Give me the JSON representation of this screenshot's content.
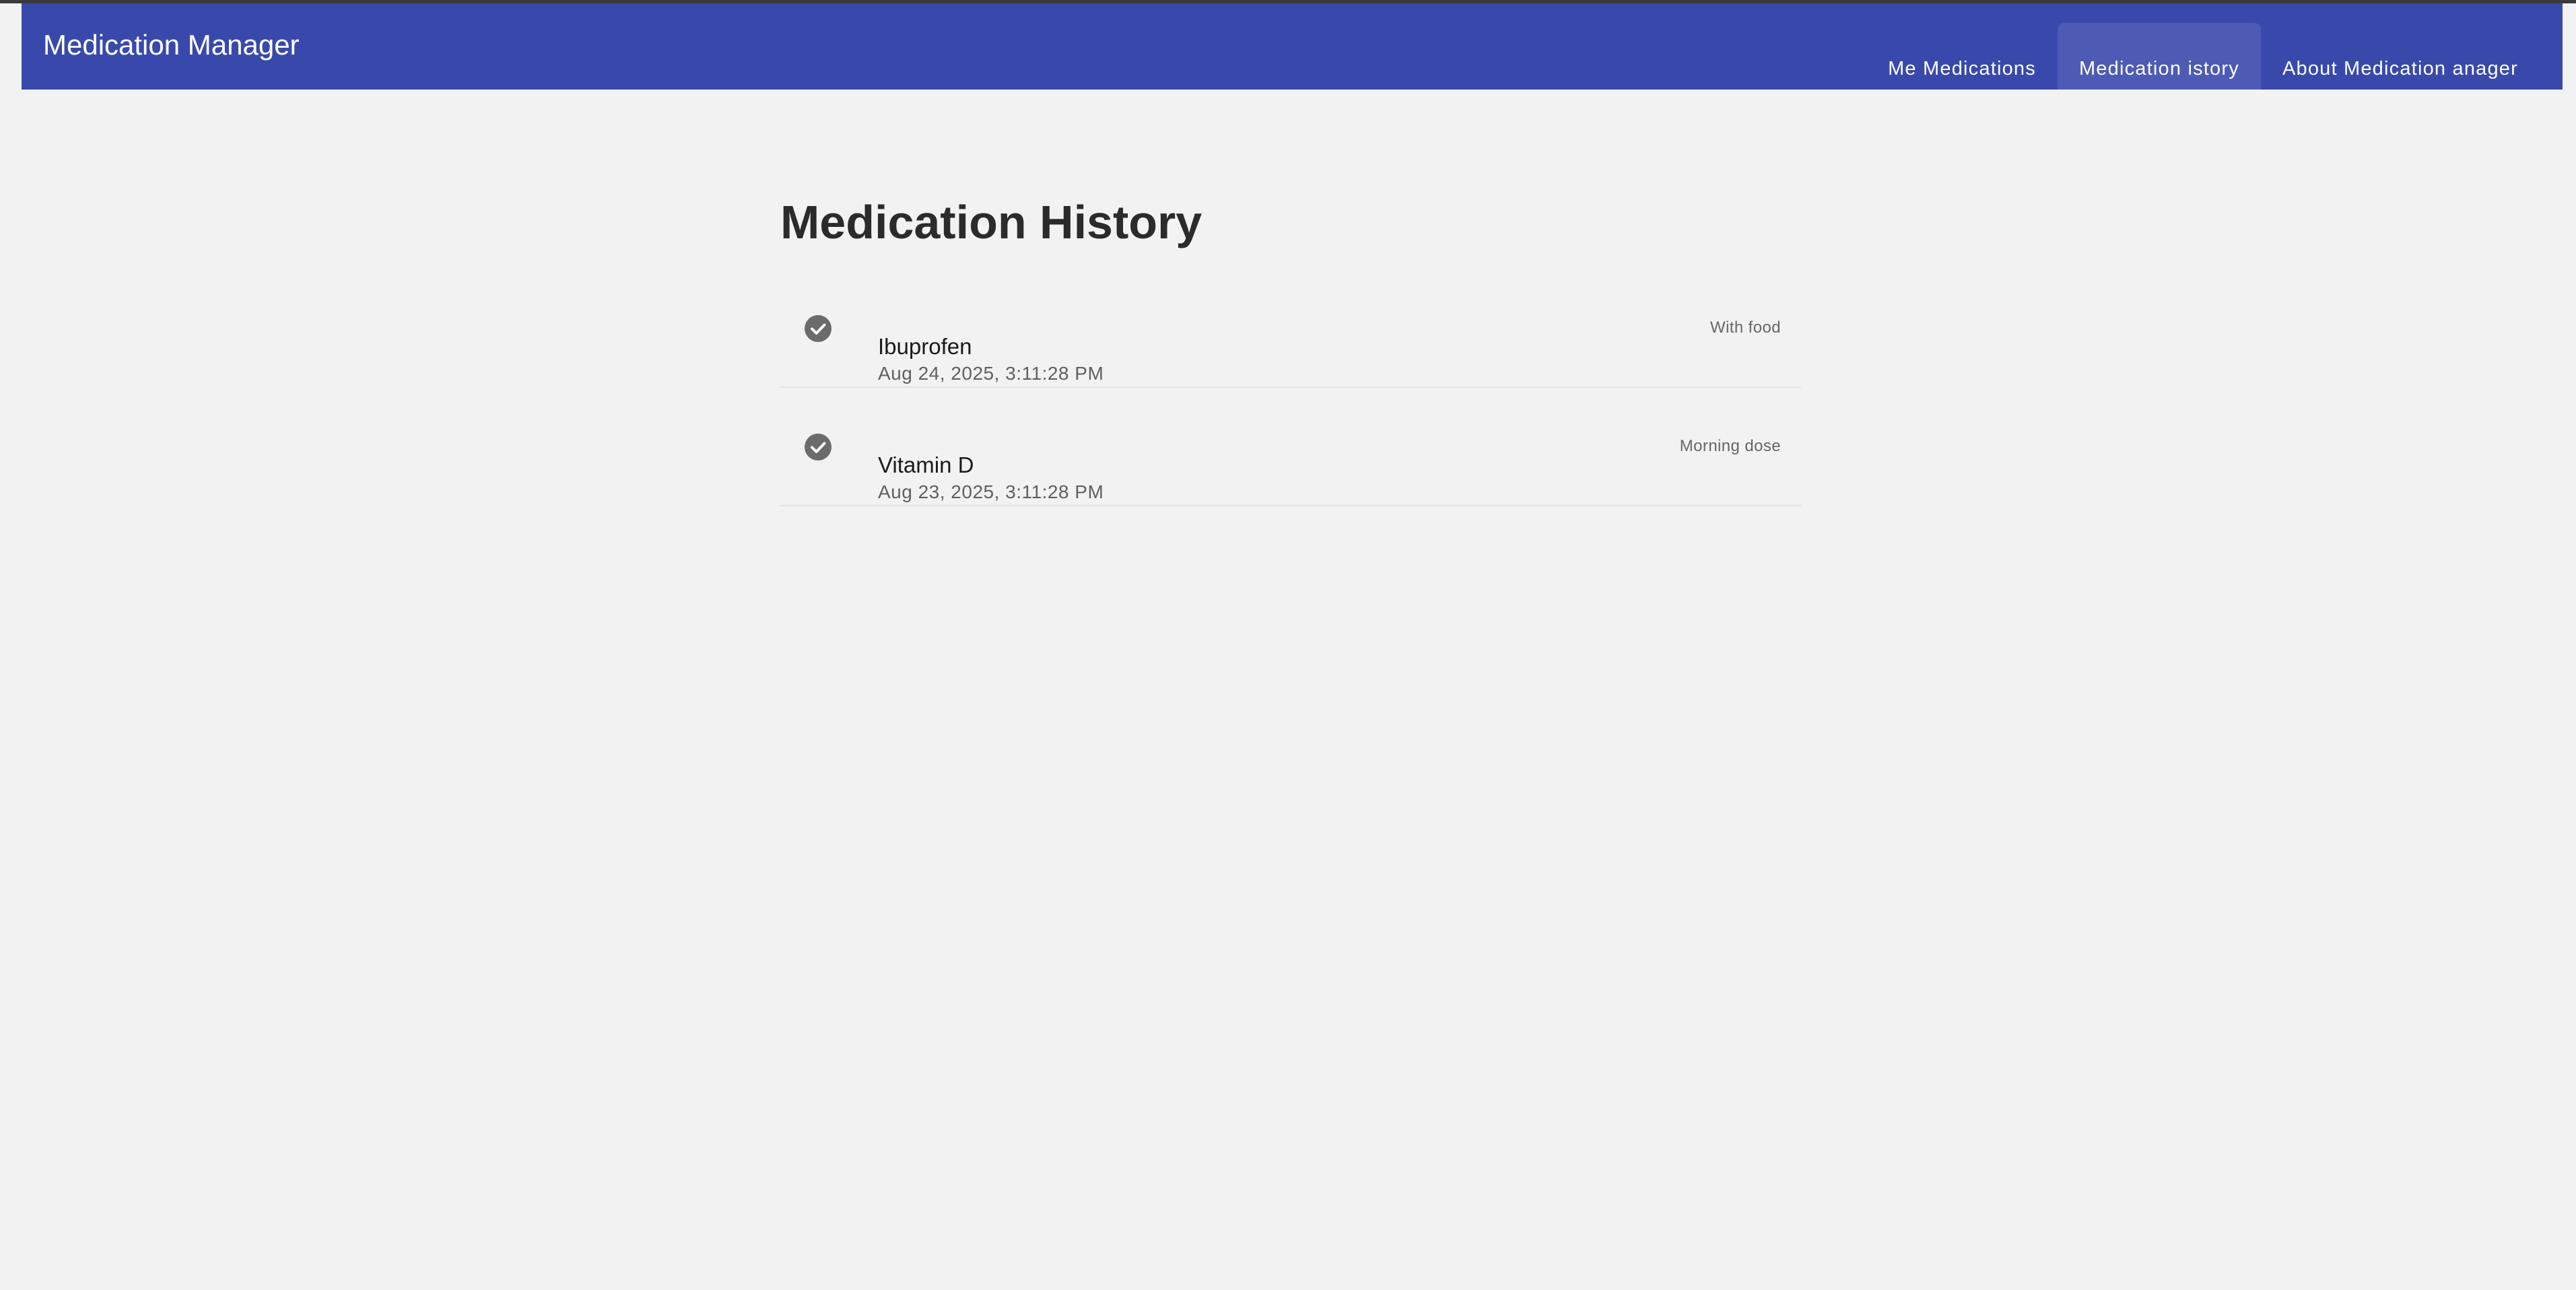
{
  "app": {
    "title": "Medication Manager",
    "accent_color": "#3949ab",
    "active_tab_color": "#4d5bb5"
  },
  "nav": {
    "tabs": [
      {
        "label": "Me Medications",
        "active": false
      },
      {
        "label": "Medication istory",
        "active": true
      },
      {
        "label": "About Medication anager",
        "active": false
      }
    ]
  },
  "page": {
    "title": "Medication History"
  },
  "history": {
    "items": [
      {
        "icon": "check-circle-icon",
        "name": "Ibuprofen",
        "time": "Aug 24, 2025, 3:11:28 PM",
        "note": "With food"
      },
      {
        "icon": "check-circle-icon",
        "name": "Vitamin D",
        "time": "Aug 23, 2025, 3:11:28 PM",
        "note": "Morning dose"
      }
    ]
  }
}
